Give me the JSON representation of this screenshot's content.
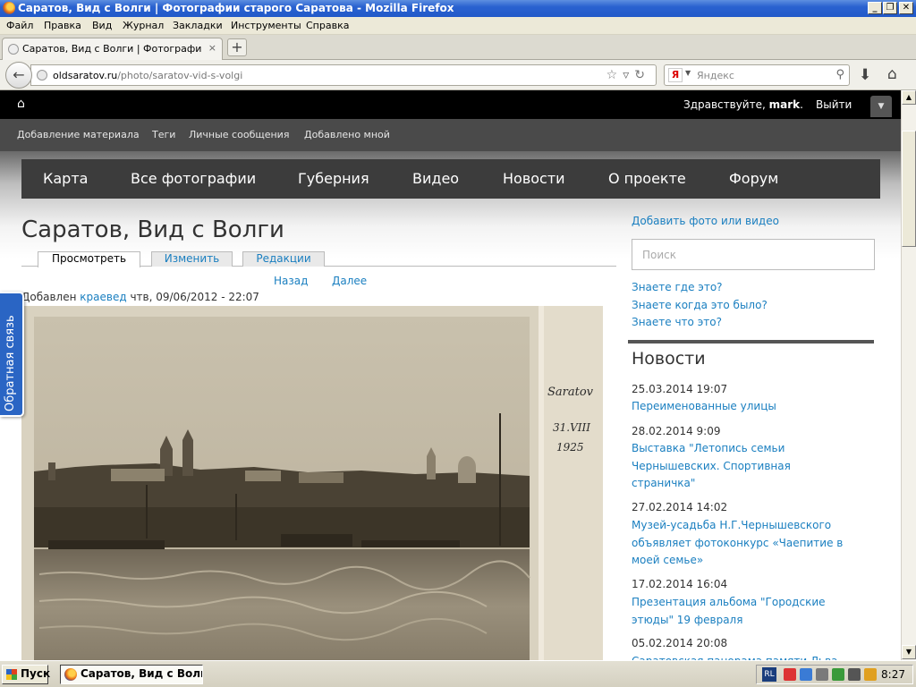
{
  "window": {
    "title": "Саратов, Вид с Волги | Фотографии старого Саратова - Mozilla Firefox",
    "minimize": "_",
    "maximize": "❐",
    "close": "✕"
  },
  "menu": [
    "Файл",
    "Правка",
    "Вид",
    "Журнал",
    "Закладки",
    "Инструменты",
    "Справка"
  ],
  "browser": {
    "tab_title": "Саратов, Вид с Волги | Фотографии старо...",
    "tab_close": "×",
    "new_tab": "+",
    "url_host": "oldsaratov.ru",
    "url_path": "/photo/saratov-vid-s-volgi",
    "search_placeholder": "Яндекс",
    "search_engine_letter": "Я"
  },
  "site": {
    "greeting_prefix": "Здравствуйте, ",
    "username": "mark",
    "greeting_suffix": ".",
    "logout": "Выйти",
    "user_links": [
      "Добавление материала",
      "Теги",
      "Личные сообщения",
      "Добавлено мной"
    ],
    "main_menu": [
      "Карта",
      "Все фотографии",
      "Губерния",
      "Видео",
      "Новости",
      "О проекте",
      "Форум"
    ]
  },
  "content": {
    "title": "Саратов, Вид с Волги",
    "tabs": [
      "Просмотреть",
      "Изменить",
      "Редакции"
    ],
    "prev": "Назад",
    "next": "Далее",
    "added_label": "Добавлен ",
    "author": "краевед",
    "added_date": " чтв, 09/06/2012 - 22:07",
    "photo_inscription_1": "Saratov",
    "photo_inscription_2": "31.VIII",
    "photo_inscription_3": "1925"
  },
  "sidebar": {
    "add_link": "Добавить фото или видео",
    "search_placeholder": "Поиск",
    "questions": [
      "Знаете где это?",
      "Знаете когда это было?",
      "Знаете что это?"
    ],
    "news_title": "Новости",
    "news": [
      {
        "date": "25.03.2014 19:07",
        "title": "Переименованные улицы"
      },
      {
        "date": "28.02.2014 9:09",
        "title": "Выставка \"Летопись семьи Чернышевских. Спортивная страничка\""
      },
      {
        "date": "27.02.2014 14:02",
        "title": "Музей-усадьба Н.Г.Чернышевского объявляет фотоконкурс «Чаепитие в моей семье»"
      },
      {
        "date": "17.02.2014 16:04",
        "title": "Презентация альбома \"Городские этюды\" 19 февраля"
      },
      {
        "date": "05.02.2014 20:08",
        "title": "Саратовская панорама памяти Льва"
      }
    ]
  },
  "feedback": "Обратная связь",
  "taskbar": {
    "start": "Пуск",
    "task": "Саратов, Вид с Волги...",
    "lang": "RL",
    "clock": "8:27"
  },
  "colors": {
    "link": "#1a7fc0",
    "menu_bg": "#3c3c3c",
    "feedback_bg": "#2a65c4"
  }
}
